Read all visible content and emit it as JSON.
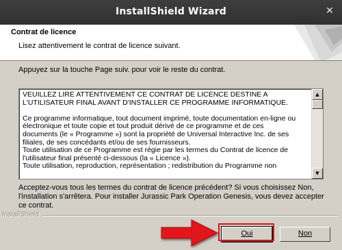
{
  "window": {
    "title": "InstallShield Wizard",
    "close_glyph": "✕"
  },
  "header": {
    "title": "Contrat de licence",
    "subtitle": "Lisez attentivement le contrat de licence suivant."
  },
  "instruction": "Appuyez sur la touche Page suiv. pour voir le reste du contrat.",
  "license": {
    "text": "VEUILLEZ LIRE ATTENTIVEMENT CE CONTRAT DE LICENCE DESTINE A\nL'UTILISATEUR FINAL AVANT D'INSTALLER CE PROGRAMME INFORMATIQUE.\n\nCe programme informatique, tout document imprimé, toute documentation en-ligne ou\nélectronique et toute copie et tout produit dérivé de ce programme et de ces\ndocuments (le « Programme ») sont la propriété de Universal Interactive Inc. de ses\nfiliales, de ses concédants et/ou de ses fournisseurs.\nToute utilisation de ce Programme est régie par les termes du Contrat de licence de\nl'utilisateur final présenté ci-dessous (la « Licence »).\nToute utilisation, reproduction, représentation ; redistribution du Programme non",
    "scroll_up_glyph": "▲",
    "scroll_down_glyph": "▼"
  },
  "question": "Acceptez-vous tous les termes du contrat de licence précédent?  Si vous choisissez Non, l'installation s'arrêtera.  Pour installer Jurassic Park Operation Genesis, vous devez accepter ce contrat.",
  "brand": "InstallShield",
  "buttons": {
    "yes": "Oui",
    "no": "Non"
  },
  "colors": {
    "highlight": "#e0131a",
    "arrow": "#e0131a",
    "titlebar": "#333333"
  },
  "icons": [
    "close-icon",
    "scroll-up-icon",
    "scroll-down-icon",
    "pointer-arrow-icon"
  ]
}
